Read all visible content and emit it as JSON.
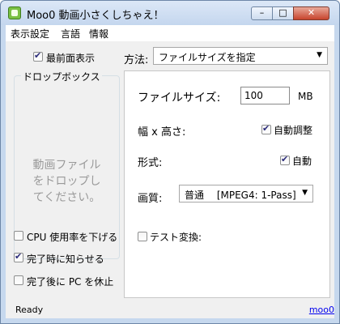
{
  "window": {
    "title": "Moo0 動画小さくしちゃえ！",
    "controls": {
      "minimize": "–",
      "maximize": "□",
      "close": "✕"
    }
  },
  "menu": [
    "表示設定",
    "言語",
    "情報"
  ],
  "left": {
    "always_on_top": {
      "label": "最前面表示",
      "checked": true
    },
    "drop_box": {
      "title": "ドロップボックス",
      "hint": "動画ファイル\nをドロップし\nてください。"
    },
    "options": [
      {
        "label": "CPU 使用率を下げる",
        "checked": false
      },
      {
        "label": "完了時に知らせる",
        "checked": true
      },
      {
        "label": "完了後に PC を休止",
        "checked": false
      }
    ]
  },
  "method": {
    "label": "方法:",
    "selected": "ファイルサイズを指定"
  },
  "panel": {
    "file_size": {
      "label": "ファイルサイズ:",
      "value": "100",
      "unit": "MB"
    },
    "dimensions": {
      "label": "幅 x 高さ:",
      "auto_label": "自動調整",
      "checked": true
    },
    "format": {
      "label": "形式:",
      "auto_label": "自動",
      "checked": true
    },
    "quality": {
      "label": "画質:",
      "selected": "普通 　[MPEG4: 1-Pass]"
    },
    "test": {
      "label": "テスト変換:",
      "checked": false
    }
  },
  "status": {
    "text": "Ready",
    "link": "moo0"
  }
}
